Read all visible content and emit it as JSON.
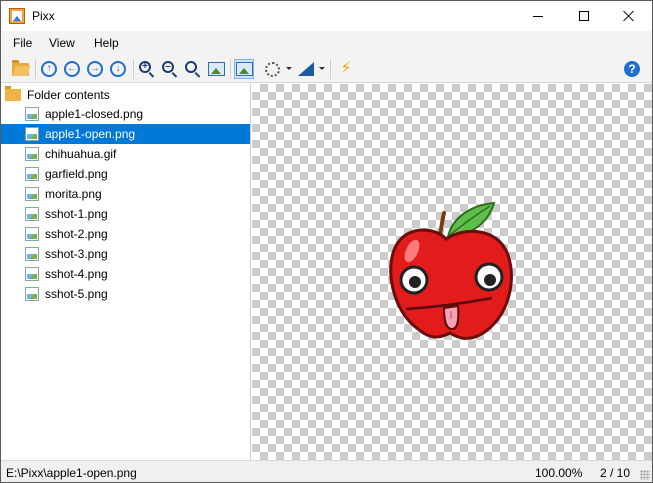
{
  "window": {
    "title": "Pixx"
  },
  "menu": {
    "items": [
      "File",
      "View",
      "Help"
    ]
  },
  "toolbar": {
    "buttons": [
      "open-folder",
      "navigate-up",
      "navigate-back",
      "navigate-forward",
      "navigate-down",
      "zoom-in",
      "zoom-out",
      "zoom-fit",
      "fit-image",
      "actual-size",
      "selection-tool",
      "color-tool",
      "quick-action",
      "help"
    ],
    "accent_color": "#1f6fd0"
  },
  "sidebar": {
    "folder_label": "Folder contents",
    "files": [
      "apple1-closed.png",
      "apple1-open.png",
      "chihuahua.gif",
      "garfield.png",
      "morita.png",
      "sshot-1.png",
      "sshot-2.png",
      "sshot-3.png",
      "sshot-4.png",
      "sshot-5.png"
    ],
    "selected_index": 1,
    "selection_color": "#0078d7"
  },
  "viewer": {
    "image": "red-apple-cartoon"
  },
  "status": {
    "path": "E:\\Pixx\\apple1-open.png",
    "zoom": "100.00%",
    "count": "2 / 10"
  }
}
